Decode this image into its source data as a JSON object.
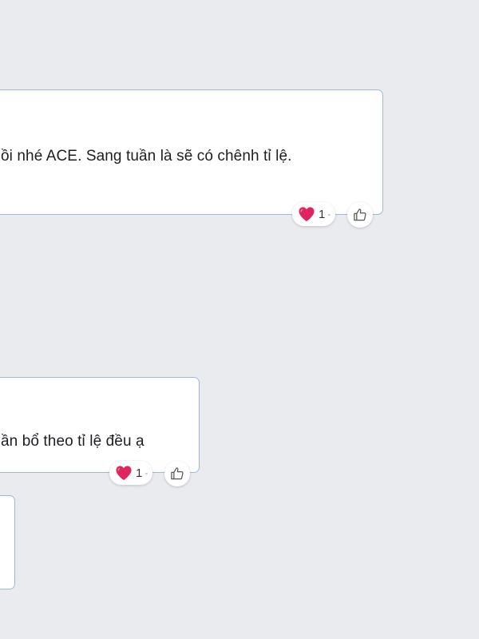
{
  "messages": [
    {
      "text": "ồi nhé ACE. Sang tuần là sẽ có chênh tỉ lệ.",
      "reaction": {
        "icon": "heart-icon",
        "count": "1",
        "separator": "-"
      },
      "like_icon": "thumbs-up-icon"
    },
    {
      "text": "ần bổ theo tỉ lệ đều ạ",
      "reaction": {
        "icon": "heart-icon",
        "count": "1",
        "separator": "-"
      },
      "like_icon": "thumbs-up-icon"
    },
    {
      "text": ""
    }
  ],
  "colors": {
    "background": "#eaebef",
    "bubble_border": "#9fb8e3",
    "heart": "#e0245e"
  }
}
